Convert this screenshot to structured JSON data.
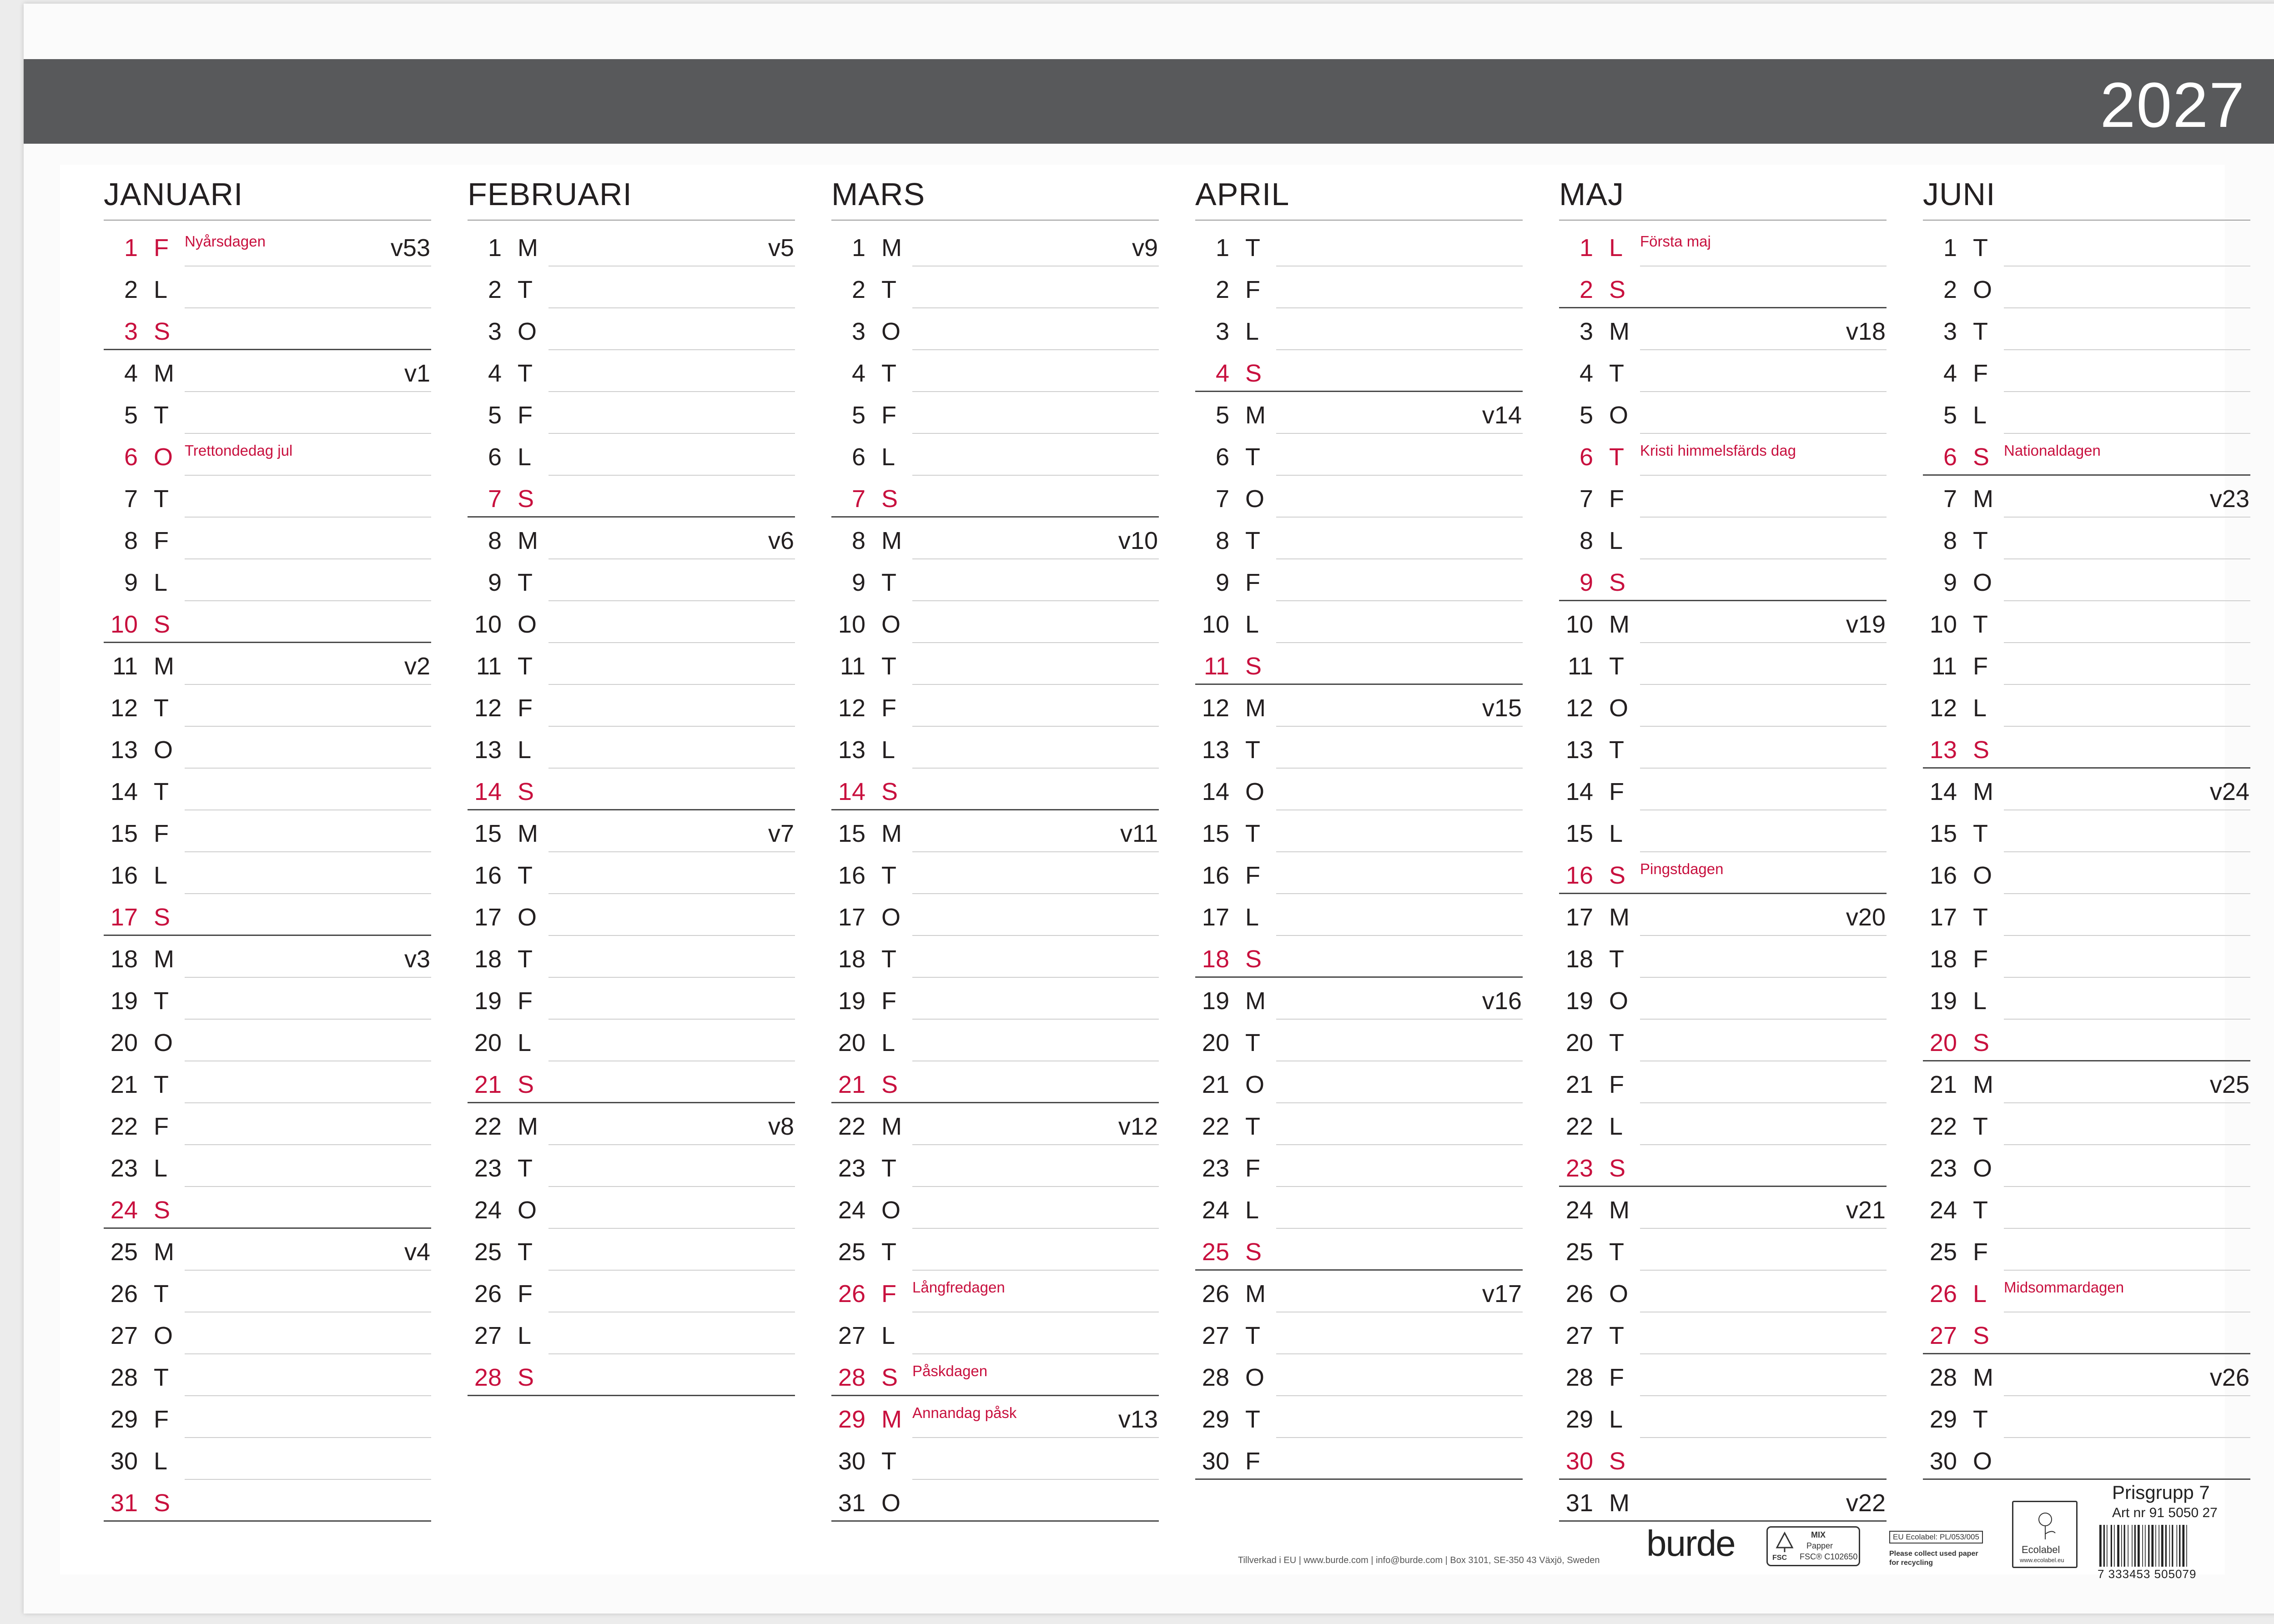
{
  "year": "2027",
  "months": [
    {
      "name": "JANUARI",
      "days": [
        {
          "n": "1",
          "d": "F",
          "red": true,
          "hol": "Nyårsdagen",
          "wk": "v53"
        },
        {
          "n": "2",
          "d": "L"
        },
        {
          "n": "3",
          "d": "S",
          "red": true
        },
        {
          "n": "4",
          "d": "M",
          "wk": "v1"
        },
        {
          "n": "5",
          "d": "T"
        },
        {
          "n": "6",
          "d": "O",
          "red": true,
          "hol": "Trettondedag jul"
        },
        {
          "n": "7",
          "d": "T"
        },
        {
          "n": "8",
          "d": "F"
        },
        {
          "n": "9",
          "d": "L"
        },
        {
          "n": "10",
          "d": "S",
          "red": true
        },
        {
          "n": "11",
          "d": "M",
          "wk": "v2"
        },
        {
          "n": "12",
          "d": "T"
        },
        {
          "n": "13",
          "d": "O"
        },
        {
          "n": "14",
          "d": "T"
        },
        {
          "n": "15",
          "d": "F"
        },
        {
          "n": "16",
          "d": "L"
        },
        {
          "n": "17",
          "d": "S",
          "red": true
        },
        {
          "n": "18",
          "d": "M",
          "wk": "v3"
        },
        {
          "n": "19",
          "d": "T"
        },
        {
          "n": "20",
          "d": "O"
        },
        {
          "n": "21",
          "d": "T"
        },
        {
          "n": "22",
          "d": "F"
        },
        {
          "n": "23",
          "d": "L"
        },
        {
          "n": "24",
          "d": "S",
          "red": true
        },
        {
          "n": "25",
          "d": "M",
          "wk": "v4"
        },
        {
          "n": "26",
          "d": "T"
        },
        {
          "n": "27",
          "d": "O"
        },
        {
          "n": "28",
          "d": "T"
        },
        {
          "n": "29",
          "d": "F"
        },
        {
          "n": "30",
          "d": "L"
        },
        {
          "n": "31",
          "d": "S",
          "red": true
        }
      ]
    },
    {
      "name": "FEBRUARI",
      "days": [
        {
          "n": "1",
          "d": "M",
          "wk": "v5"
        },
        {
          "n": "2",
          "d": "T"
        },
        {
          "n": "3",
          "d": "O"
        },
        {
          "n": "4",
          "d": "T"
        },
        {
          "n": "5",
          "d": "F"
        },
        {
          "n": "6",
          "d": "L"
        },
        {
          "n": "7",
          "d": "S",
          "red": true
        },
        {
          "n": "8",
          "d": "M",
          "wk": "v6"
        },
        {
          "n": "9",
          "d": "T"
        },
        {
          "n": "10",
          "d": "O"
        },
        {
          "n": "11",
          "d": "T"
        },
        {
          "n": "12",
          "d": "F"
        },
        {
          "n": "13",
          "d": "L"
        },
        {
          "n": "14",
          "d": "S",
          "red": true
        },
        {
          "n": "15",
          "d": "M",
          "wk": "v7"
        },
        {
          "n": "16",
          "d": "T"
        },
        {
          "n": "17",
          "d": "O"
        },
        {
          "n": "18",
          "d": "T"
        },
        {
          "n": "19",
          "d": "F"
        },
        {
          "n": "20",
          "d": "L"
        },
        {
          "n": "21",
          "d": "S",
          "red": true
        },
        {
          "n": "22",
          "d": "M",
          "wk": "v8"
        },
        {
          "n": "23",
          "d": "T"
        },
        {
          "n": "24",
          "d": "O"
        },
        {
          "n": "25",
          "d": "T"
        },
        {
          "n": "26",
          "d": "F"
        },
        {
          "n": "27",
          "d": "L"
        },
        {
          "n": "28",
          "d": "S",
          "red": true
        }
      ]
    },
    {
      "name": "MARS",
      "days": [
        {
          "n": "1",
          "d": "M",
          "wk": "v9"
        },
        {
          "n": "2",
          "d": "T"
        },
        {
          "n": "3",
          "d": "O"
        },
        {
          "n": "4",
          "d": "T"
        },
        {
          "n": "5",
          "d": "F"
        },
        {
          "n": "6",
          "d": "L"
        },
        {
          "n": "7",
          "d": "S",
          "red": true
        },
        {
          "n": "8",
          "d": "M",
          "wk": "v10"
        },
        {
          "n": "9",
          "d": "T"
        },
        {
          "n": "10",
          "d": "O"
        },
        {
          "n": "11",
          "d": "T"
        },
        {
          "n": "12",
          "d": "F"
        },
        {
          "n": "13",
          "d": "L"
        },
        {
          "n": "14",
          "d": "S",
          "red": true
        },
        {
          "n": "15",
          "d": "M",
          "wk": "v11"
        },
        {
          "n": "16",
          "d": "T"
        },
        {
          "n": "17",
          "d": "O"
        },
        {
          "n": "18",
          "d": "T"
        },
        {
          "n": "19",
          "d": "F"
        },
        {
          "n": "20",
          "d": "L"
        },
        {
          "n": "21",
          "d": "S",
          "red": true
        },
        {
          "n": "22",
          "d": "M",
          "wk": "v12"
        },
        {
          "n": "23",
          "d": "T"
        },
        {
          "n": "24",
          "d": "O"
        },
        {
          "n": "25",
          "d": "T"
        },
        {
          "n": "26",
          "d": "F",
          "red": true,
          "hol": "Långfredagen"
        },
        {
          "n": "27",
          "d": "L"
        },
        {
          "n": "28",
          "d": "S",
          "red": true,
          "hol": "Påskdagen"
        },
        {
          "n": "29",
          "d": "M",
          "red": true,
          "hol": "Annandag påsk",
          "wk": "v13"
        },
        {
          "n": "30",
          "d": "T"
        },
        {
          "n": "31",
          "d": "O"
        }
      ]
    },
    {
      "name": "APRIL",
      "days": [
        {
          "n": "1",
          "d": "T"
        },
        {
          "n": "2",
          "d": "F"
        },
        {
          "n": "3",
          "d": "L"
        },
        {
          "n": "4",
          "d": "S",
          "red": true
        },
        {
          "n": "5",
          "d": "M",
          "wk": "v14"
        },
        {
          "n": "6",
          "d": "T"
        },
        {
          "n": "7",
          "d": "O"
        },
        {
          "n": "8",
          "d": "T"
        },
        {
          "n": "9",
          "d": "F"
        },
        {
          "n": "10",
          "d": "L"
        },
        {
          "n": "11",
          "d": "S",
          "red": true
        },
        {
          "n": "12",
          "d": "M",
          "wk": "v15"
        },
        {
          "n": "13",
          "d": "T"
        },
        {
          "n": "14",
          "d": "O"
        },
        {
          "n": "15",
          "d": "T"
        },
        {
          "n": "16",
          "d": "F"
        },
        {
          "n": "17",
          "d": "L"
        },
        {
          "n": "18",
          "d": "S",
          "red": true
        },
        {
          "n": "19",
          "d": "M",
          "wk": "v16"
        },
        {
          "n": "20",
          "d": "T"
        },
        {
          "n": "21",
          "d": "O"
        },
        {
          "n": "22",
          "d": "T"
        },
        {
          "n": "23",
          "d": "F"
        },
        {
          "n": "24",
          "d": "L"
        },
        {
          "n": "25",
          "d": "S",
          "red": true
        },
        {
          "n": "26",
          "d": "M",
          "wk": "v17"
        },
        {
          "n": "27",
          "d": "T"
        },
        {
          "n": "28",
          "d": "O"
        },
        {
          "n": "29",
          "d": "T"
        },
        {
          "n": "30",
          "d": "F"
        }
      ]
    },
    {
      "name": "MAJ",
      "days": [
        {
          "n": "1",
          "d": "L",
          "red": true,
          "hol": "Första maj"
        },
        {
          "n": "2",
          "d": "S",
          "red": true
        },
        {
          "n": "3",
          "d": "M",
          "wk": "v18"
        },
        {
          "n": "4",
          "d": "T"
        },
        {
          "n": "5",
          "d": "O"
        },
        {
          "n": "6",
          "d": "T",
          "red": true,
          "hol": "Kristi himmelsfärds dag"
        },
        {
          "n": "7",
          "d": "F"
        },
        {
          "n": "8",
          "d": "L"
        },
        {
          "n": "9",
          "d": "S",
          "red": true
        },
        {
          "n": "10",
          "d": "M",
          "wk": "v19"
        },
        {
          "n": "11",
          "d": "T"
        },
        {
          "n": "12",
          "d": "O"
        },
        {
          "n": "13",
          "d": "T"
        },
        {
          "n": "14",
          "d": "F"
        },
        {
          "n": "15",
          "d": "L"
        },
        {
          "n": "16",
          "d": "S",
          "red": true,
          "hol": "Pingstdagen"
        },
        {
          "n": "17",
          "d": "M",
          "wk": "v20"
        },
        {
          "n": "18",
          "d": "T"
        },
        {
          "n": "19",
          "d": "O"
        },
        {
          "n": "20",
          "d": "T"
        },
        {
          "n": "21",
          "d": "F"
        },
        {
          "n": "22",
          "d": "L"
        },
        {
          "n": "23",
          "d": "S",
          "red": true
        },
        {
          "n": "24",
          "d": "M",
          "wk": "v21"
        },
        {
          "n": "25",
          "d": "T"
        },
        {
          "n": "26",
          "d": "O"
        },
        {
          "n": "27",
          "d": "T"
        },
        {
          "n": "28",
          "d": "F"
        },
        {
          "n": "29",
          "d": "L"
        },
        {
          "n": "30",
          "d": "S",
          "red": true
        },
        {
          "n": "31",
          "d": "M",
          "wk": "v22"
        }
      ]
    },
    {
      "name": "JUNI",
      "days": [
        {
          "n": "1",
          "d": "T"
        },
        {
          "n": "2",
          "d": "O"
        },
        {
          "n": "3",
          "d": "T"
        },
        {
          "n": "4",
          "d": "F"
        },
        {
          "n": "5",
          "d": "L"
        },
        {
          "n": "6",
          "d": "S",
          "red": true,
          "hol": "Nationaldagen"
        },
        {
          "n": "7",
          "d": "M",
          "wk": "v23"
        },
        {
          "n": "8",
          "d": "T"
        },
        {
          "n": "9",
          "d": "O"
        },
        {
          "n": "10",
          "d": "T"
        },
        {
          "n": "11",
          "d": "F"
        },
        {
          "n": "12",
          "d": "L"
        },
        {
          "n": "13",
          "d": "S",
          "red": true
        },
        {
          "n": "14",
          "d": "M",
          "wk": "v24"
        },
        {
          "n": "15",
          "d": "T"
        },
        {
          "n": "16",
          "d": "O"
        },
        {
          "n": "17",
          "d": "T"
        },
        {
          "n": "18",
          "d": "F"
        },
        {
          "n": "19",
          "d": "L"
        },
        {
          "n": "20",
          "d": "S",
          "red": true
        },
        {
          "n": "21",
          "d": "M",
          "wk": "v25"
        },
        {
          "n": "22",
          "d": "T"
        },
        {
          "n": "23",
          "d": "O"
        },
        {
          "n": "24",
          "d": "T"
        },
        {
          "n": "25",
          "d": "F"
        },
        {
          "n": "26",
          "d": "L",
          "red": true,
          "hol": "Midsommardagen"
        },
        {
          "n": "27",
          "d": "S",
          "red": true
        },
        {
          "n": "28",
          "d": "M",
          "wk": "v26"
        },
        {
          "n": "29",
          "d": "T"
        },
        {
          "n": "30",
          "d": "O"
        }
      ]
    }
  ],
  "footer": {
    "address": "Tillverkad i EU   |   www.burde.com   |   info@burde.com   |   Box 3101, SE-350 43 Växjö, Sweden",
    "brand": "burde",
    "fsc_label": "MIX",
    "fsc_paper": "Papper",
    "fsc_code": "FSC® C102650",
    "fsc_logo": "FSC",
    "ecolabel_code": "EU Ecolabel: PL/053/005",
    "recycle_note_1": "Please collect used paper",
    "recycle_note_2": "for recycling",
    "ecolabel_url": "www.ecolabel.eu",
    "ecolabel_mark": "Ecolabel",
    "prisgrupp": "Prisgrupp 7",
    "artnr": "Art nr 91 5050 27",
    "barcode_number": "7 333453 505079"
  }
}
